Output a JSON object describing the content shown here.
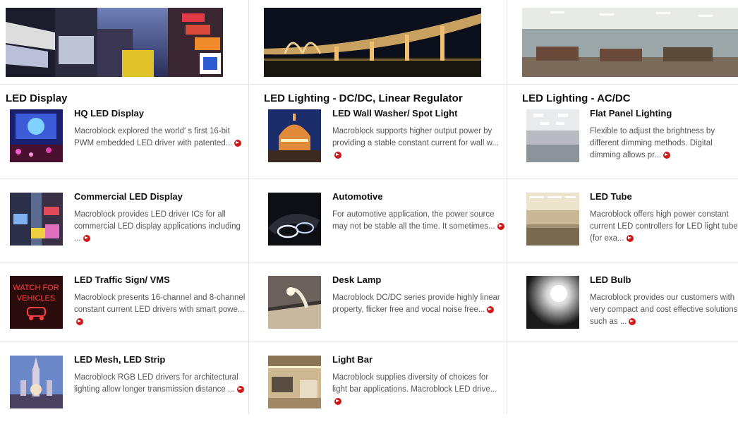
{
  "columns": [
    {
      "title": "LED Display",
      "items": [
        {
          "title": "HQ LED Display",
          "desc": "Macroblock explored the world' s first 16-bit PWM embedded LED driver with patented..."
        },
        {
          "title": "Commercial LED Display",
          "desc": "Macroblock provides LED driver ICs for all commercial LED display applications including ..."
        },
        {
          "title": "LED Traffic Sign/ VMS",
          "desc": "Macroblock presents 16-channel and 8-channel constant current LED drivers with smart powe..."
        },
        {
          "title": "LED Mesh, LED Strip",
          "desc": "Macroblock RGB LED drivers for architectural lighting allow longer transmission distance ..."
        }
      ]
    },
    {
      "title": "LED Lighting - DC/DC, Linear Regulator",
      "items": [
        {
          "title": "LED Wall Washer/ Spot Light",
          "desc": "Macroblock supports higher output power by providing a stable constant current for wall w..."
        },
        {
          "title": "Automotive",
          "desc": "For automotive application, the power source may not be stable all the time. It sometimes..."
        },
        {
          "title": "Desk Lamp",
          "desc": "Macroblock DC/DC series provide highly linear property, flicker free and vocal noise free..."
        },
        {
          "title": "Light Bar",
          "desc": "Macroblock supplies diversity of choices for light bar applications. Macroblock LED drive..."
        }
      ]
    },
    {
      "title": "LED Lighting - AC/DC",
      "items": [
        {
          "title": "Flat Panel Lighting",
          "desc": "Flexible to adjust the brightness by different dimming methods. Digital dimming allows pr..."
        },
        {
          "title": "LED Tube",
          "desc": "Macroblock offers high power constant current LED controllers for LED light tube (for exa..."
        },
        {
          "title": "LED Bulb",
          "desc": "Macroblock provides our customers with very compact and cost effective solutions such as ..."
        }
      ]
    }
  ],
  "thumb_text": {
    "traffic_sign": "WATCH FOR VEHICLES"
  },
  "colors": {
    "more_arrow": "#d01818",
    "divider": "#e4e4e4"
  }
}
